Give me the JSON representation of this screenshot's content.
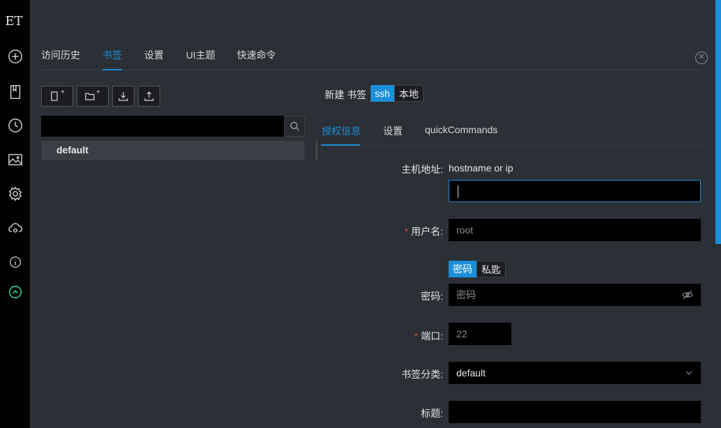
{
  "app": {
    "logo_text": "ET"
  },
  "sidebar": {
    "icons": [
      "add-icon",
      "bookmark-icon",
      "history-icon",
      "image-icon",
      "gear-icon",
      "cloud-sync-icon",
      "info-icon",
      "upgrade-icon"
    ]
  },
  "top_tabs": [
    "访问历史",
    "书签",
    "设置",
    "UI主题",
    "快速命令"
  ],
  "active_top_tab": "书签",
  "toolbar": {
    "new_bookmark_plus": "+",
    "new_folder_plus": "+"
  },
  "search": {
    "placeholder": "",
    "value": ""
  },
  "tree": {
    "items": [
      "default"
    ]
  },
  "form_header": {
    "new_label": "新建 书签",
    "type_options": [
      "ssh",
      "本地"
    ],
    "active_type": "ssh"
  },
  "sub_tabs": [
    "授权信息",
    "设置",
    "quickCommands"
  ],
  "active_sub_tab": "授权信息",
  "form": {
    "host_label": "主机地址:",
    "host_hint": "hostname or ip",
    "host_value": "",
    "username_label": "用户名:",
    "username_placeholder": "root",
    "auth_options": [
      "密码",
      "私匙"
    ],
    "active_auth": "密码",
    "password_label": "密码:",
    "password_placeholder": "密码",
    "port_label": "端口:",
    "port_value": "22",
    "category_label": "书签分类:",
    "category_value": "default",
    "title_label": "标题:",
    "title_value": ""
  },
  "colors": {
    "accent": "#1c8fd8",
    "required": "#e0453a",
    "sidebar_bg": "#000000",
    "bg": "#2b2f36"
  }
}
